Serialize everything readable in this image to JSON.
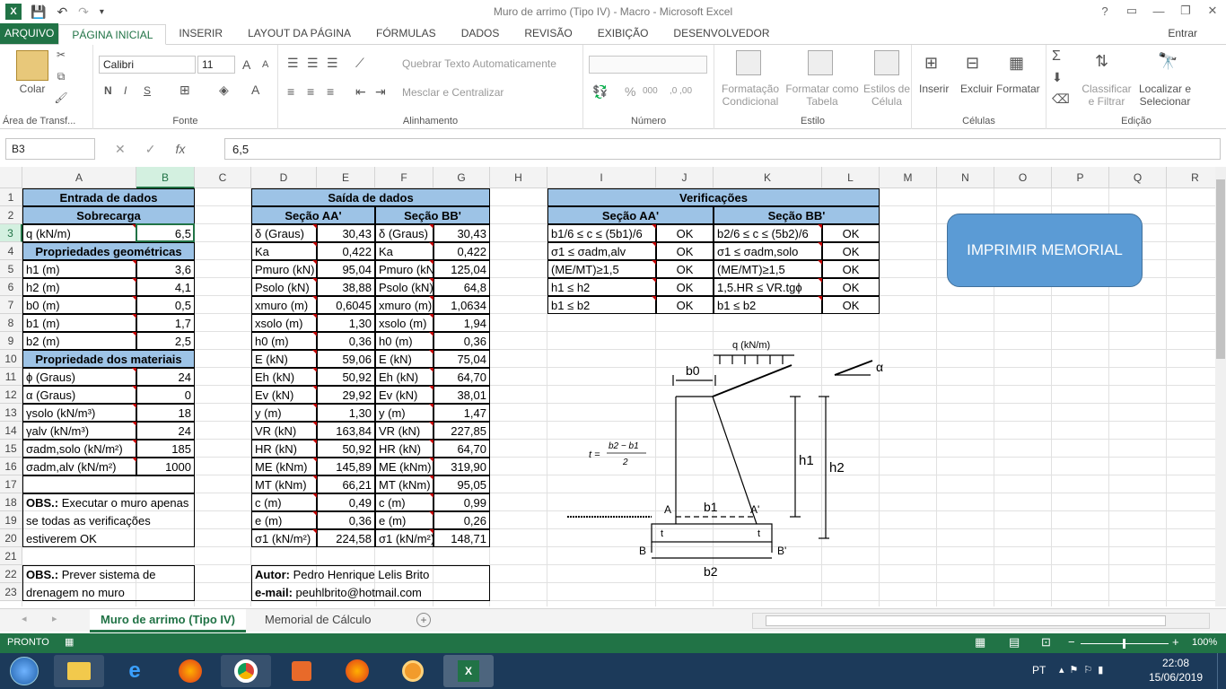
{
  "window": {
    "title": "Muro de arrimo (Tipo IV) - Macro - Microsoft Excel",
    "help": "?",
    "controls": [
      "—",
      "❐",
      "✕"
    ]
  },
  "ribbon_tabs": [
    "ARQUIVO",
    "PÁGINA INICIAL",
    "INSERIR",
    "LAYOUT DA PÁGINA",
    "FÓRMULAS",
    "DADOS",
    "REVISÃO",
    "EXIBIÇÃO",
    "DESENVOLVEDOR"
  ],
  "account": "Entrar",
  "ribbon": {
    "clipboard": {
      "paste": "Colar",
      "group": "Área de Transf..."
    },
    "font": {
      "name": "Calibri",
      "size": "11",
      "bold": "N",
      "italic": "I",
      "underline": "S",
      "grow": "A",
      "shrink": "A",
      "color": "A",
      "group": "Fonte"
    },
    "alignment": {
      "wrap": "Quebrar Texto Automaticamente",
      "merge": "Mesclar e Centralizar",
      "group": "Alinhamento"
    },
    "number": {
      "percent": "%",
      "thousands": "000",
      "group": "Número"
    },
    "styles": {
      "conditional": [
        "Formatação",
        "Condicional"
      ],
      "table": [
        "Formatar como",
        "Tabela"
      ],
      "cell": [
        "Estilos de",
        "Célula"
      ],
      "group": "Estilo"
    },
    "cells": {
      "insert": "Inserir",
      "delete": "Excluir",
      "format": "Formatar",
      "group": "Células"
    },
    "editing": {
      "sort": [
        "Classificar",
        "e Filtrar"
      ],
      "find": [
        "Localizar e",
        "Selecionar"
      ],
      "group": "Edição"
    }
  },
  "formula_bar": {
    "name_box": "B3",
    "fx": "fx",
    "value": "6,5"
  },
  "columns": [
    "A",
    "B",
    "C",
    "D",
    "E",
    "F",
    "G",
    "H",
    "I",
    "J",
    "K",
    "L",
    "M",
    "N",
    "O",
    "P",
    "Q",
    "R"
  ],
  "rows": [
    "1",
    "2",
    "3",
    "4",
    "5",
    "6",
    "7",
    "8",
    "9",
    "10",
    "11",
    "12",
    "13",
    "14",
    "15",
    "16",
    "17",
    "18",
    "19",
    "20",
    "21",
    "22",
    "23"
  ],
  "entrada": {
    "title": "Entrada de dados",
    "sobrecarga": "Sobrecarga",
    "q": {
      "label": "q (kN/m)",
      "value": "6,5"
    },
    "geom_title": "Propriedades geométricas",
    "geom": [
      {
        "label": "h1 (m)",
        "value": "3,6"
      },
      {
        "label": "h2 (m)",
        "value": "4,1"
      },
      {
        "label": "b0 (m)",
        "value": "0,5"
      },
      {
        "label": "b1 (m)",
        "value": "1,7"
      },
      {
        "label": "b2 (m)",
        "value": "2,5"
      }
    ],
    "mat_title": "Propriedade dos materiais",
    "mat": [
      {
        "label": "ϕ (Graus)",
        "value": "24"
      },
      {
        "label": "α (Graus)",
        "value": "0"
      },
      {
        "label": "γsolo (kN/m³)",
        "value": "18"
      },
      {
        "label": "γalv (kN/m³)",
        "value": "24"
      },
      {
        "label": "σadm,solo (kN/m²)",
        "value": "185"
      },
      {
        "label": "σadm,alv (kN/m²)",
        "value": "1000"
      }
    ],
    "obs1_bold": "OBS.:",
    "obs1": [
      " Executar o muro apenas",
      "se todas as verificações",
      "estiverem OK"
    ],
    "obs2_bold": "OBS.:",
    "obs2": [
      " Prever sistema de",
      "drenagem no muro"
    ]
  },
  "saida": {
    "title": "Saída de dados",
    "secao_aa": "Seção AA'",
    "secao_bb": "Seção BB'",
    "rows": [
      {
        "la": "δ (Graus)",
        "va": "30,43",
        "lb": "δ (Graus)",
        "vb": "30,43"
      },
      {
        "la": "Ka",
        "va": "0,422",
        "lb": "Ka",
        "vb": "0,422"
      },
      {
        "la": "Pmuro (kN)",
        "va": "95,04",
        "lb": "Pmuro (kN)",
        "vb": "125,04"
      },
      {
        "la": "Psolo (kN)",
        "va": "38,88",
        "lb": "Psolo (kN)",
        "vb": "64,8"
      },
      {
        "la": "xmuro (m)",
        "va": "0,6045",
        "lb": "xmuro (m)",
        "vb": "1,0634"
      },
      {
        "la": "xsolo (m)",
        "va": "1,30",
        "lb": "xsolo (m)",
        "vb": "1,94"
      },
      {
        "la": "h0 (m)",
        "va": "0,36",
        "lb": "h0 (m)",
        "vb": "0,36"
      },
      {
        "la": "E (kN)",
        "va": "59,06",
        "lb": "E (kN)",
        "vb": "75,04"
      },
      {
        "la": "Eh (kN)",
        "va": "50,92",
        "lb": "Eh (kN)",
        "vb": "64,70"
      },
      {
        "la": "Ev (kN)",
        "va": "29,92",
        "lb": "Ev (kN)",
        "vb": "38,01"
      },
      {
        "la": "y (m)",
        "va": "1,30",
        "lb": "y (m)",
        "vb": "1,47"
      },
      {
        "la": "VR (kN)",
        "va": "163,84",
        "lb": "VR (kN)",
        "vb": "227,85"
      },
      {
        "la": "HR (kN)",
        "va": "50,92",
        "lb": "HR (kN)",
        "vb": "64,70"
      },
      {
        "la": "ME (kNm)",
        "va": "145,89",
        "lb": "ME (kNm)",
        "vb": "319,90"
      },
      {
        "la": "MT (kNm)",
        "va": "66,21",
        "lb": "MT (kNm)",
        "vb": "95,05"
      },
      {
        "la": "c (m)",
        "va": "0,49",
        "lb": "c (m)",
        "vb": "0,99"
      },
      {
        "la": "e (m)",
        "va": "0,36",
        "lb": "e (m)",
        "vb": "0,26"
      },
      {
        "la": "σ1 (kN/m²)",
        "va": "224,58",
        "lb": "σ1 (kN/m²)",
        "vb": "148,71"
      }
    ],
    "autor_bold": "Autor:",
    "autor": " Pedro Henrique Lelis Brito",
    "email_bold": "e-mail:",
    "email": " peuhlbrito@hotmail.com"
  },
  "verificacoes": {
    "title": "Verificações",
    "secao_aa": "Seção AA'",
    "secao_bb": "Seção BB'",
    "rows": [
      {
        "la": "b1/6 ≤ c ≤ (5b1)/6",
        "va": "OK",
        "lb": "b2/6 ≤ c ≤ (5b2)/6",
        "vb": "OK"
      },
      {
        "la": "σ1 ≤ σadm,alv",
        "va": "OK",
        "lb": "σ1 ≤ σadm,solo",
        "vb": "OK"
      },
      {
        "la": "(ME/MT)≥1,5",
        "va": "OK",
        "lb": "(ME/MT)≥1,5",
        "vb": "OK"
      },
      {
        "la": "h1 ≤ h2",
        "va": "OK",
        "lb": "1,5.HR ≤ VR.tgϕ",
        "vb": "OK"
      },
      {
        "la": "b1 ≤ b2",
        "va": "OK",
        "lb": "b1 ≤ b2",
        "vb": "OK"
      }
    ]
  },
  "button": "IMPRIMIR MEMORIAL",
  "diagram": {
    "q": "q (kN/m)",
    "b0": "b0",
    "alpha": "α",
    "h1": "h1",
    "h2": "h2",
    "b1": "b1",
    "b2": "b2",
    "A": "A",
    "A2": "A'",
    "B": "B",
    "B2": "B'",
    "t": "t",
    "formula_lhs": "t =",
    "formula_num": "b2 − b1",
    "formula_den": "2"
  },
  "sheets": [
    "Muro de arrimo (Tipo IV)",
    "Memorial de Cálculo"
  ],
  "status": {
    "left": "PRONTO",
    "zoom": "100%",
    "minus": "−",
    "plus": "+"
  },
  "taskbar": {
    "lang": "PT",
    "time": "22:08",
    "date": "15/06/2019"
  },
  "colors": {
    "accent": "#217346",
    "header_fill": "#9dc3e6",
    "button": "#5b9bd5",
    "comment": "#c00000"
  }
}
